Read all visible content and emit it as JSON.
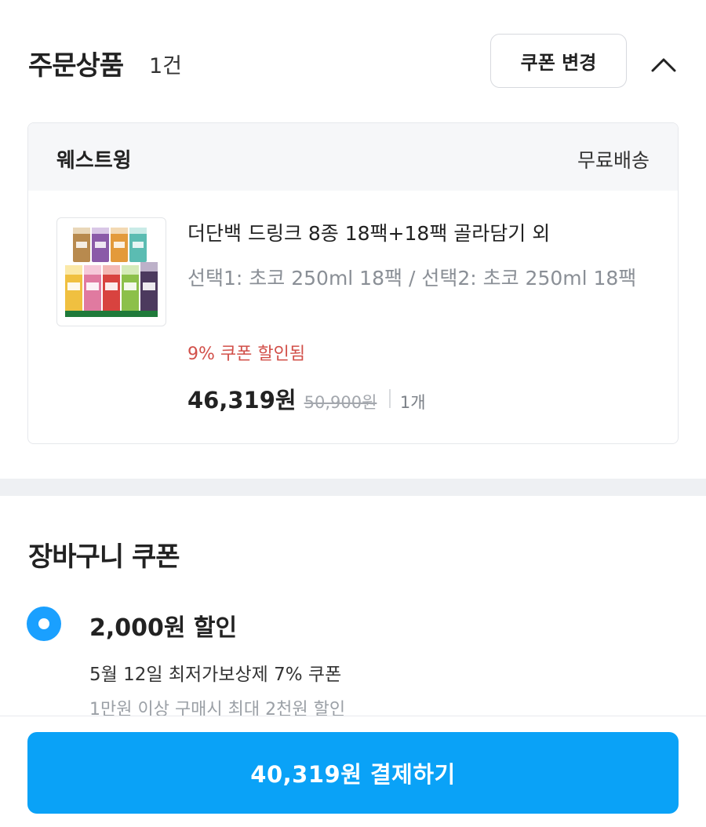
{
  "order": {
    "title": "주문상품",
    "count": "1건",
    "change_coupon_label": "쿠폰 변경",
    "collapse_icon": "chevron-up-icon"
  },
  "seller": {
    "name": "웨스트윙",
    "shipping": "무료배송"
  },
  "product": {
    "thumbnail_icon": "product-pack-image",
    "name": "더단백 드링크 8종 18팩+18팩 골라담기 외",
    "option": "선택1: 초코 250ml 18팩 / 선택2: 초코 250ml 18팩",
    "discount_note": "9% 쿠폰 할인됨",
    "sale_price": "46,319원",
    "original_price": "50,900원",
    "quantity": "1개"
  },
  "cart_coupon": {
    "title": "장바구니 쿠폰",
    "amount": "2,000원 할인",
    "description": "5월 12일 최저가보상제 7% 쿠폰",
    "condition": "1만원 이상 구매시 최대 2천원 할인"
  },
  "checkout": {
    "pay_label": "40,319원 결제하기"
  },
  "colors": {
    "accent": "#0aa2f7",
    "discount": "#d2504a",
    "muted": "#8a8f96"
  }
}
